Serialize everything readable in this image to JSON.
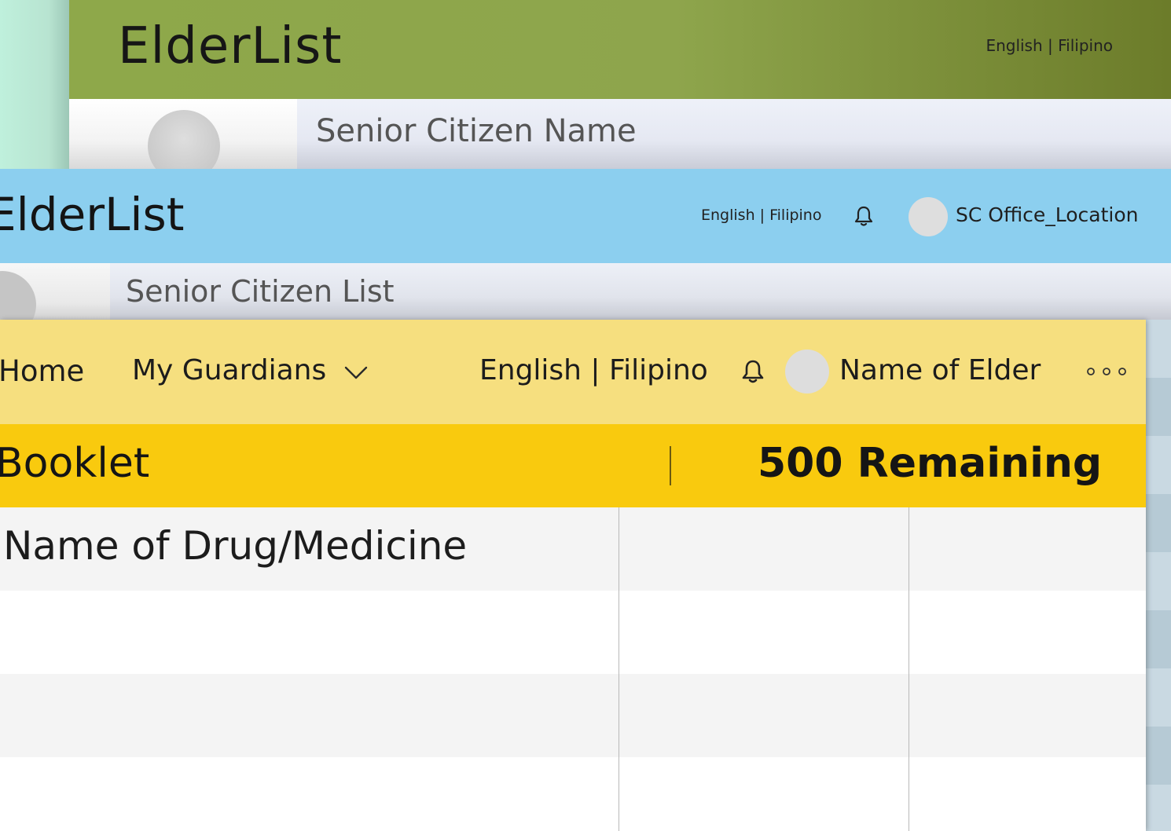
{
  "layer_back": {
    "app_title": "ElderList",
    "language_toggle": "English | Filipino",
    "sub_header_label": "Senior Citizen Name"
  },
  "layer_middle": {
    "app_title": "ElderList",
    "language_toggle": "English | Filipino",
    "user_label": "SC Office_Location",
    "sub_header_label": "Senior Citizen List"
  },
  "layer_front": {
    "nav": {
      "home": "Home",
      "guardians": "My Guardians",
      "language_toggle": "English | Filipino",
      "user_label": "Name of Elder"
    },
    "booklet": {
      "label": "Booklet",
      "remaining": "500 Remaining"
    },
    "table": {
      "header": "Name of Drug/Medicine",
      "rows": [
        "",
        "",
        ""
      ]
    }
  },
  "icons": [
    "bell-icon",
    "chevron-down-icon",
    "more-icon"
  ],
  "colors": {
    "back_header": "#8ea84a",
    "middle_header": "#8ccfef",
    "front_nav": "#f6df7f",
    "booklet_bar": "#f9ca0e"
  }
}
